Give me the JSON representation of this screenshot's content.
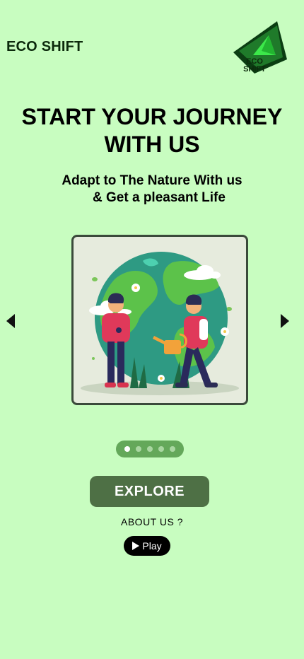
{
  "header": {
    "brand": "ECO SHIFT",
    "logo_line1": "ECO",
    "logo_line2": "SHIFT"
  },
  "hero": {
    "title_line1": "START YOUR JOURNEY",
    "title_line2": "WITH US",
    "subtitle_line1": "Adapt to The Nature With us",
    "subtitle_line2": "& Get a pleasant Life"
  },
  "carousel": {
    "slide_count": 5,
    "active_index": 0,
    "illustration": "earth-care-illustration"
  },
  "actions": {
    "explore_label": "EXPLORE",
    "about_label": "ABOUT US ?",
    "play_label": "Play"
  },
  "colors": {
    "background": "#c8fdc0",
    "explore_button": "#4e7045",
    "dots_pill": "#64a85a",
    "brand_text": "#0c2a0c"
  }
}
